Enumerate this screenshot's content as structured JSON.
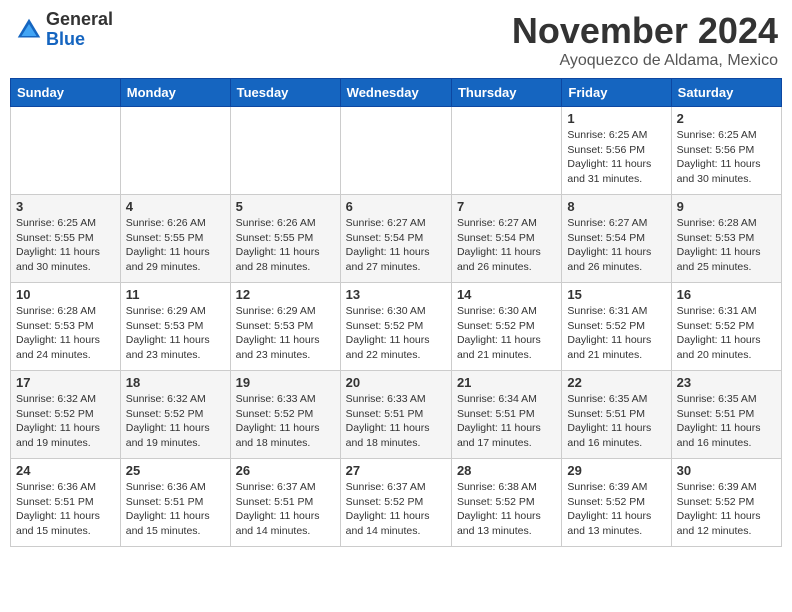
{
  "logo": {
    "general": "General",
    "blue": "Blue"
  },
  "title": "November 2024",
  "location": "Ayoquezco de Aldama, Mexico",
  "days_header": [
    "Sunday",
    "Monday",
    "Tuesday",
    "Wednesday",
    "Thursday",
    "Friday",
    "Saturday"
  ],
  "weeks": [
    [
      {
        "day": "",
        "info": ""
      },
      {
        "day": "",
        "info": ""
      },
      {
        "day": "",
        "info": ""
      },
      {
        "day": "",
        "info": ""
      },
      {
        "day": "",
        "info": ""
      },
      {
        "day": "1",
        "info": "Sunrise: 6:25 AM\nSunset: 5:56 PM\nDaylight: 11 hours and 31 minutes."
      },
      {
        "day": "2",
        "info": "Sunrise: 6:25 AM\nSunset: 5:56 PM\nDaylight: 11 hours and 30 minutes."
      }
    ],
    [
      {
        "day": "3",
        "info": "Sunrise: 6:25 AM\nSunset: 5:55 PM\nDaylight: 11 hours and 30 minutes."
      },
      {
        "day": "4",
        "info": "Sunrise: 6:26 AM\nSunset: 5:55 PM\nDaylight: 11 hours and 29 minutes."
      },
      {
        "day": "5",
        "info": "Sunrise: 6:26 AM\nSunset: 5:55 PM\nDaylight: 11 hours and 28 minutes."
      },
      {
        "day": "6",
        "info": "Sunrise: 6:27 AM\nSunset: 5:54 PM\nDaylight: 11 hours and 27 minutes."
      },
      {
        "day": "7",
        "info": "Sunrise: 6:27 AM\nSunset: 5:54 PM\nDaylight: 11 hours and 26 minutes."
      },
      {
        "day": "8",
        "info": "Sunrise: 6:27 AM\nSunset: 5:54 PM\nDaylight: 11 hours and 26 minutes."
      },
      {
        "day": "9",
        "info": "Sunrise: 6:28 AM\nSunset: 5:53 PM\nDaylight: 11 hours and 25 minutes."
      }
    ],
    [
      {
        "day": "10",
        "info": "Sunrise: 6:28 AM\nSunset: 5:53 PM\nDaylight: 11 hours and 24 minutes."
      },
      {
        "day": "11",
        "info": "Sunrise: 6:29 AM\nSunset: 5:53 PM\nDaylight: 11 hours and 23 minutes."
      },
      {
        "day": "12",
        "info": "Sunrise: 6:29 AM\nSunset: 5:53 PM\nDaylight: 11 hours and 23 minutes."
      },
      {
        "day": "13",
        "info": "Sunrise: 6:30 AM\nSunset: 5:52 PM\nDaylight: 11 hours and 22 minutes."
      },
      {
        "day": "14",
        "info": "Sunrise: 6:30 AM\nSunset: 5:52 PM\nDaylight: 11 hours and 21 minutes."
      },
      {
        "day": "15",
        "info": "Sunrise: 6:31 AM\nSunset: 5:52 PM\nDaylight: 11 hours and 21 minutes."
      },
      {
        "day": "16",
        "info": "Sunrise: 6:31 AM\nSunset: 5:52 PM\nDaylight: 11 hours and 20 minutes."
      }
    ],
    [
      {
        "day": "17",
        "info": "Sunrise: 6:32 AM\nSunset: 5:52 PM\nDaylight: 11 hours and 19 minutes."
      },
      {
        "day": "18",
        "info": "Sunrise: 6:32 AM\nSunset: 5:52 PM\nDaylight: 11 hours and 19 minutes."
      },
      {
        "day": "19",
        "info": "Sunrise: 6:33 AM\nSunset: 5:52 PM\nDaylight: 11 hours and 18 minutes."
      },
      {
        "day": "20",
        "info": "Sunrise: 6:33 AM\nSunset: 5:51 PM\nDaylight: 11 hours and 18 minutes."
      },
      {
        "day": "21",
        "info": "Sunrise: 6:34 AM\nSunset: 5:51 PM\nDaylight: 11 hours and 17 minutes."
      },
      {
        "day": "22",
        "info": "Sunrise: 6:35 AM\nSunset: 5:51 PM\nDaylight: 11 hours and 16 minutes."
      },
      {
        "day": "23",
        "info": "Sunrise: 6:35 AM\nSunset: 5:51 PM\nDaylight: 11 hours and 16 minutes."
      }
    ],
    [
      {
        "day": "24",
        "info": "Sunrise: 6:36 AM\nSunset: 5:51 PM\nDaylight: 11 hours and 15 minutes."
      },
      {
        "day": "25",
        "info": "Sunrise: 6:36 AM\nSunset: 5:51 PM\nDaylight: 11 hours and 15 minutes."
      },
      {
        "day": "26",
        "info": "Sunrise: 6:37 AM\nSunset: 5:51 PM\nDaylight: 11 hours and 14 minutes."
      },
      {
        "day": "27",
        "info": "Sunrise: 6:37 AM\nSunset: 5:52 PM\nDaylight: 11 hours and 14 minutes."
      },
      {
        "day": "28",
        "info": "Sunrise: 6:38 AM\nSunset: 5:52 PM\nDaylight: 11 hours and 13 minutes."
      },
      {
        "day": "29",
        "info": "Sunrise: 6:39 AM\nSunset: 5:52 PM\nDaylight: 11 hours and 13 minutes."
      },
      {
        "day": "30",
        "info": "Sunrise: 6:39 AM\nSunset: 5:52 PM\nDaylight: 11 hours and 12 minutes."
      }
    ]
  ]
}
